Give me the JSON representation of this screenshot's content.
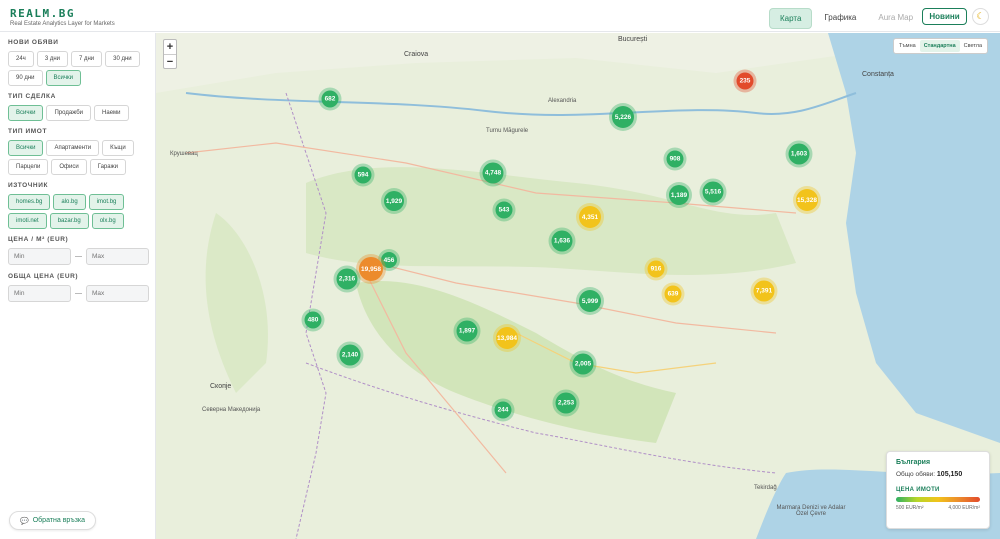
{
  "header": {
    "brand_title": "REALM.BG",
    "brand_subtitle": "Real Estate Analytics Layer for Markets",
    "tabs": [
      {
        "label": "Карта",
        "state": "active"
      },
      {
        "label": "Графика",
        "state": "normal"
      },
      {
        "label": "Aura Map",
        "state": "disabled"
      }
    ],
    "news_button": "Новини",
    "theme_icon": "moon-icon"
  },
  "sidebar": {
    "new_listings": {
      "title": "НОВИ ОБЯВИ",
      "options": [
        "24ч",
        "3 дни",
        "7 дни",
        "30 дни",
        "90 дни",
        "Всички"
      ],
      "selected": "Всички"
    },
    "deal_type": {
      "title": "ТИП СДЕЛКА",
      "options": [
        "Всички",
        "Продажби",
        "Наеми"
      ],
      "selected": "Всички"
    },
    "property_type": {
      "title": "ТИП ИМОТ",
      "options": [
        "Всички",
        "Апартаменти",
        "Къщи",
        "Парцели",
        "Офиси",
        "Гаражи"
      ],
      "selected": "Всички"
    },
    "source": {
      "title": "ИЗТОЧНИК",
      "options": [
        "homes.bg",
        "alo.bg",
        "imot.bg",
        "imoti.net",
        "bazar.bg",
        "olx.bg"
      ]
    },
    "price_per_m2": {
      "title": "ЦЕНА / M² (EUR)",
      "min_placeholder": "Min",
      "max_placeholder": "Max",
      "dash": "—"
    },
    "total_price": {
      "title": "ОБЩА ЦЕНА (EUR)",
      "min_placeholder": "Min",
      "max_placeholder": "Max",
      "dash": "—"
    },
    "feedback": "Обратна връзка"
  },
  "map": {
    "zoom_in": "+",
    "zoom_out": "−",
    "styles": [
      "Тъмна",
      "Стандартна",
      "Светла"
    ],
    "selected_style": "Стандартна",
    "labels": [
      {
        "text": "Craiova",
        "kind": "city"
      },
      {
        "text": "București",
        "kind": "city"
      },
      {
        "text": "Constanța",
        "kind": "city"
      },
      {
        "text": "Alexandria",
        "kind": "town"
      },
      {
        "text": "Turnu Măgurele",
        "kind": "town"
      },
      {
        "text": "Крушевац",
        "kind": "town"
      },
      {
        "text": "Скопје",
        "kind": "city"
      },
      {
        "text": "Северна Македонија",
        "kind": "town"
      },
      {
        "text": "Tekirdağ",
        "kind": "town"
      },
      {
        "text": "Marmara Denizi ve Adalar Özel Çevre",
        "kind": "town"
      }
    ],
    "clusters": [
      {
        "count": "682",
        "level": "green"
      },
      {
        "count": "5,226",
        "level": "green"
      },
      {
        "count": "235",
        "level": "red"
      },
      {
        "count": "594",
        "level": "green"
      },
      {
        "count": "4,748",
        "level": "green"
      },
      {
        "count": "908",
        "level": "green"
      },
      {
        "count": "1,603",
        "level": "green"
      },
      {
        "count": "1,929",
        "level": "green"
      },
      {
        "count": "543",
        "level": "green"
      },
      {
        "count": "1,189",
        "level": "green"
      },
      {
        "count": "5,516",
        "level": "green"
      },
      {
        "count": "15,328",
        "level": "yellow"
      },
      {
        "count": "4,351",
        "level": "yellow"
      },
      {
        "count": "1,636",
        "level": "green"
      },
      {
        "count": "456",
        "level": "green"
      },
      {
        "count": "19,958",
        "level": "orange"
      },
      {
        "count": "2,316",
        "level": "green"
      },
      {
        "count": "916",
        "level": "yellow"
      },
      {
        "count": "639",
        "level": "yellow"
      },
      {
        "count": "7,391",
        "level": "yellow"
      },
      {
        "count": "5,999",
        "level": "green"
      },
      {
        "count": "480",
        "level": "green"
      },
      {
        "count": "1,897",
        "level": "green"
      },
      {
        "count": "13,984",
        "level": "yellow"
      },
      {
        "count": "2,140",
        "level": "green"
      },
      {
        "count": "2,005",
        "level": "green"
      },
      {
        "count": "2,253",
        "level": "green"
      },
      {
        "count": "244",
        "level": "green"
      }
    ],
    "legend": {
      "title": "България",
      "total_label": "Общо обяви:",
      "total_value": "105,150",
      "price_title": "ЦЕНА ИМОТИ",
      "range_min": "500 EUR/m²",
      "range_max": "4,000 EUR/m²"
    }
  },
  "colors": {
    "accent": "#1b7f5a",
    "green": "#2fb064",
    "yellow": "#f2c31b",
    "orange": "#ec8b2c",
    "red": "#e24a2b"
  }
}
